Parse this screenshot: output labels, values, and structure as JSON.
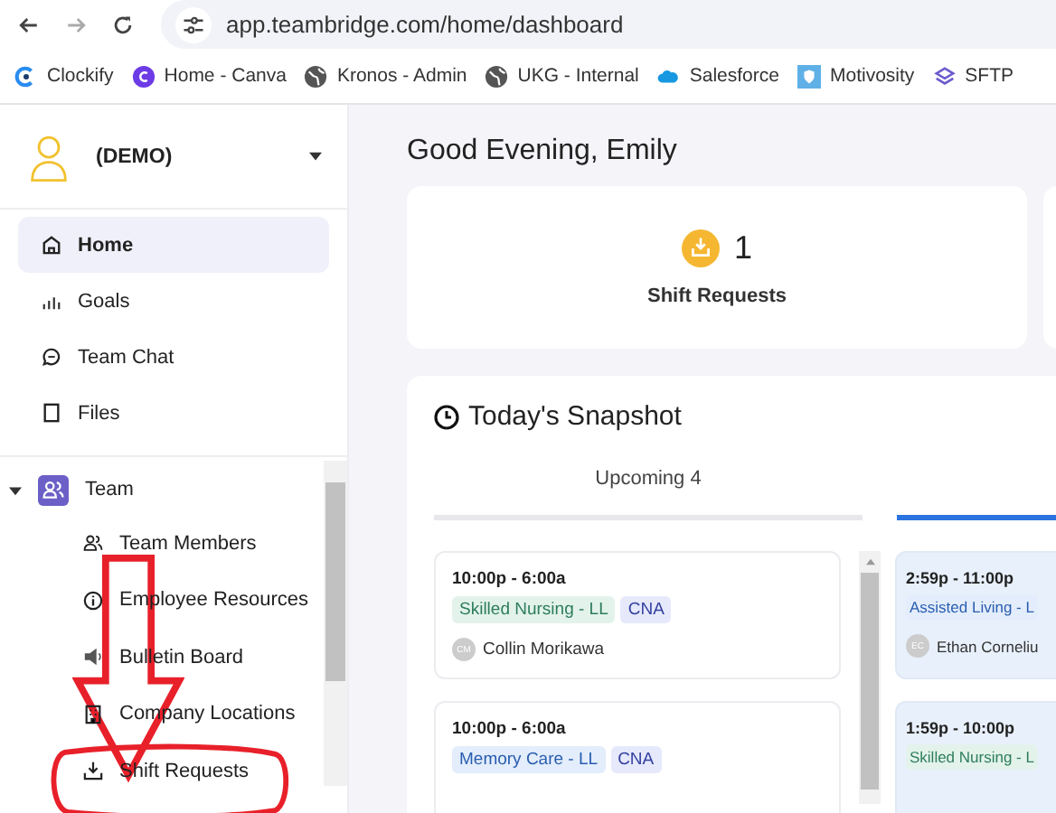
{
  "browser": {
    "url": "app.teambridge.com/home/dashboard",
    "bookmarks": [
      {
        "label": "Clockify",
        "kind": "clockify"
      },
      {
        "label": "Home - Canva",
        "kind": "canva"
      },
      {
        "label": "Kronos - Admin",
        "kind": "globe"
      },
      {
        "label": "UKG - Internal",
        "kind": "globe"
      },
      {
        "label": "Salesforce",
        "kind": "cloud"
      },
      {
        "label": "Motivosity",
        "kind": "shield"
      },
      {
        "label": "SFTP",
        "kind": "layers"
      }
    ]
  },
  "sidebar": {
    "org": "(DEMO)",
    "items": [
      {
        "label": "Home",
        "kind": "home",
        "selected": true
      },
      {
        "label": "Goals",
        "kind": "bars",
        "selected": false
      },
      {
        "label": "Team Chat",
        "kind": "chat",
        "selected": false
      },
      {
        "label": "Files",
        "kind": "file",
        "selected": false
      }
    ],
    "section": {
      "label": "Team",
      "expanded": true,
      "children": [
        {
          "label": "Team Members",
          "kind": "people",
          "selected": false
        },
        {
          "label": "Employee Resources",
          "kind": "info",
          "selected": false
        },
        {
          "label": "Bulletin Board",
          "kind": "speaker",
          "selected": false
        },
        {
          "label": "Company Locations",
          "kind": "building",
          "selected": false
        },
        {
          "label": "Shift Requests",
          "kind": "download",
          "selected": false
        }
      ]
    }
  },
  "greeting": "Good Evening, Emily",
  "stat_card": {
    "count": "1",
    "label": "Shift Requests"
  },
  "snapshot": {
    "title": "Today's Snapshot",
    "tabs": [
      {
        "label": "Upcoming 4",
        "selected": false
      },
      {
        "selected": true
      }
    ],
    "columns": [
      [
        {
          "time": "10:00p - 6:00a",
          "tags": [
            {
              "label": "Skilled Nursing - LL",
              "color": "#e3f3ec"
            },
            {
              "label": "CNA",
              "color": "#e6e9fb"
            }
          ],
          "initials": "CM",
          "name": "Collin Morikawa"
        },
        {
          "time": "10:00p - 6:00a",
          "tags": [
            {
              "label": "Memory Care - LL",
              "color": "#e3edfb"
            },
            {
              "label": "CNA",
              "color": "#e6e9fb"
            }
          ]
        }
      ],
      [
        {
          "time": "2:59p - 11:00p",
          "tags": [
            {
              "label": "Assisted Living - L",
              "color": "#e3edfb"
            }
          ],
          "initials": "EC",
          "name": "Ethan Corneliu"
        },
        {
          "time": "1:59p - 10:00p",
          "tags": [
            {
              "label": "Skilled Nursing - L",
              "color": "#e3f3ec"
            }
          ]
        }
      ]
    ]
  }
}
